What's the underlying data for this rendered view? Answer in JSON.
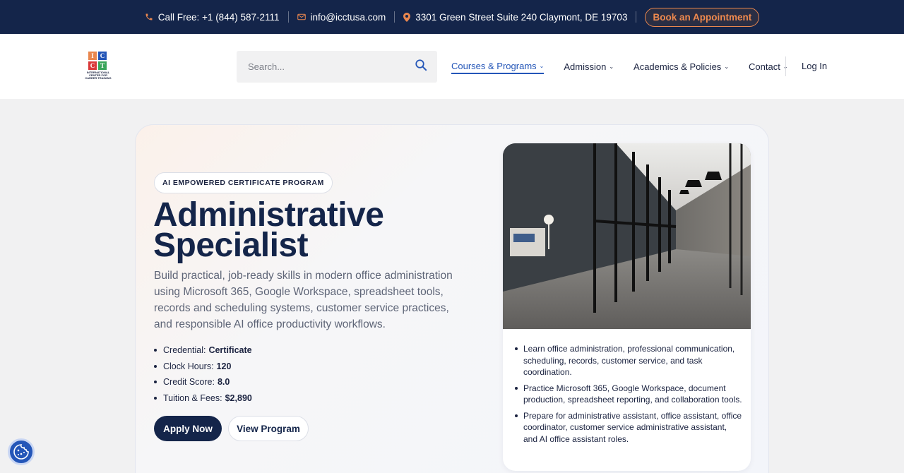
{
  "topbar": {
    "phone": "Call Free: +1 (844) 587-2111",
    "email": "info@icctusa.com",
    "address": "3301 Green Street Suite 240 Claymont, DE 19703",
    "book_label": "Book an Appointment"
  },
  "logo": {
    "letters": [
      "I",
      "C",
      "C",
      "T"
    ],
    "tagline": "INTERNATIONAL CENTER FOR CAREER TRAINING"
  },
  "search": {
    "placeholder": "Search..."
  },
  "nav": {
    "items": [
      {
        "label": "Courses & Programs"
      },
      {
        "label": "Admission"
      },
      {
        "label": "Academics & Policies"
      },
      {
        "label": "Contact"
      }
    ],
    "login": "Log In"
  },
  "program": {
    "badge": "AI EMPOWERED CERTIFICATE PROGRAM",
    "title": "Administrative Specialist",
    "description": "Build practical, job-ready skills in modern office administration using Microsoft 365, Google Workspace, spreadsheet tools, records and scheduling systems, customer service practices, and responsible AI office productivity workflows.",
    "facts": [
      {
        "label": "Credential:",
        "value": "Certificate"
      },
      {
        "label": "Clock Hours:",
        "value": "120"
      },
      {
        "label": "Credit Score:",
        "value": "8.0"
      },
      {
        "label": "Tuition & Fees:",
        "value": "$2,890"
      }
    ],
    "apply_label": "Apply Now",
    "view_label": "View Program",
    "highlights": [
      "Learn office administration, professional communication, scheduling, records, customer service, and task coordination.",
      "Practice Microsoft 365, Google Workspace, document production, spreadsheet reporting, and collaboration tools.",
      "Prepare for administrative assistant, office assistant, office coordinator, customer service administrative assistant, and AI office assistant roles."
    ]
  },
  "colors": {
    "navy": "#14254a",
    "accent_orange": "#e9874f",
    "link_blue": "#2456b8"
  }
}
